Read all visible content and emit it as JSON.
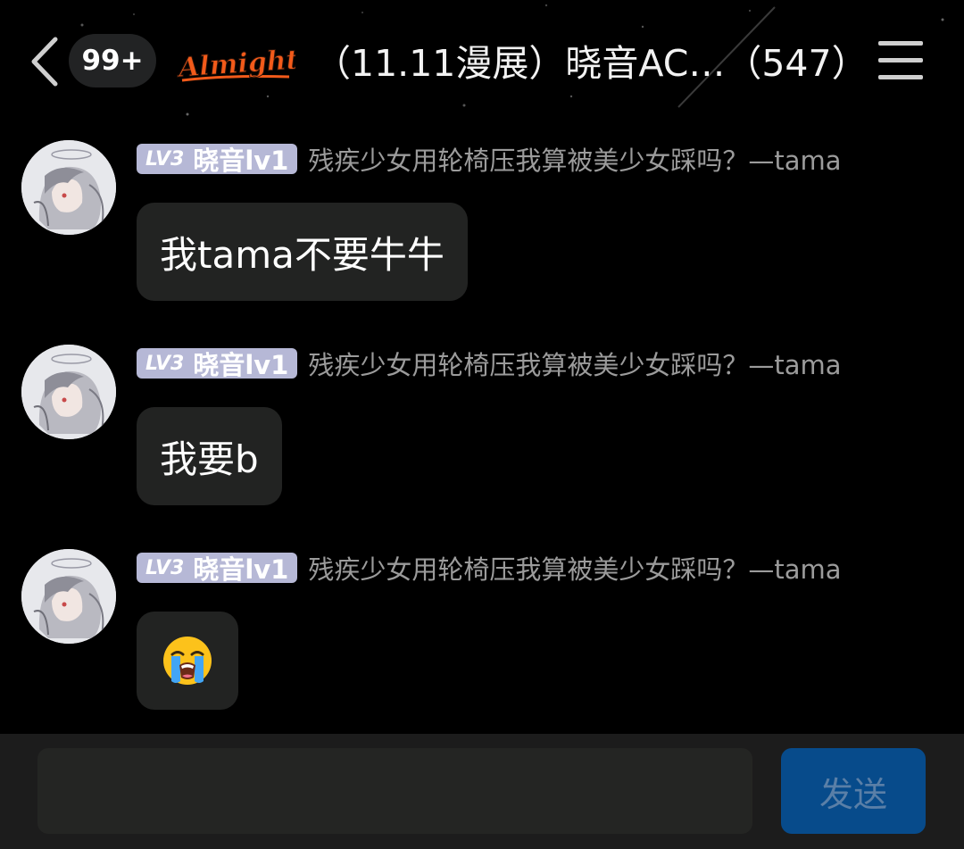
{
  "header": {
    "unread_count": "99+",
    "brand_logo_text": "Almighty",
    "title": "（11.11漫展）晓音AC…（547）"
  },
  "messages": [
    {
      "level": "LV3",
      "nickname": "晓音lv1",
      "group_title": "残疾少女用轮椅压我算被美少女踩吗？—tama",
      "text": "我tama不要牛牛"
    },
    {
      "level": "LV3",
      "nickname": "晓音lv1",
      "group_title": "残疾少女用轮椅压我算被美少女踩吗？—tama",
      "text": "我要b"
    },
    {
      "level": "LV3",
      "nickname": "晓音lv1",
      "group_title": "残疾少女用轮椅压我算被美少女踩吗？—tama",
      "emoji": "loudly-crying-face-icon"
    }
  ],
  "input": {
    "value": "",
    "send_label": "发送"
  },
  "colors": {
    "background": "#000000",
    "bubble": "#222322",
    "level_tag": "#b6b8d6",
    "send_button": "#074b8b",
    "send_text": "#5a7fa7",
    "muted_text": "#9b9b9b"
  }
}
